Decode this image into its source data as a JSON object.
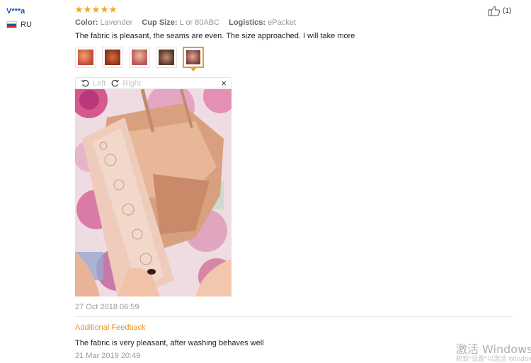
{
  "reviewer": {
    "name": "V***a",
    "country_code": "RU",
    "flag_icon": "russia-flag-icon"
  },
  "rating": {
    "stars": 5,
    "max": 5,
    "color": "#f5a623"
  },
  "attributes": [
    {
      "label": "Color:",
      "value": "Lavender"
    },
    {
      "label": "Cup Size:",
      "value": "L or 80ABC"
    },
    {
      "label": "Logistics:",
      "value": "ePacket"
    }
  ],
  "review_text": "The fabric is pleasant, the seams are even. The size approached. I will take more",
  "thumbnails": {
    "count": 5,
    "active_index": 4,
    "active_border_color": "#e79a36"
  },
  "viewer": {
    "rotate_left_label": "Left",
    "rotate_right_label": "Right",
    "close_glyph": "×"
  },
  "review_date": "27 Oct 2018 06:59",
  "additional_feedback": {
    "title": "Additional Feedback",
    "text": "The fabric is very pleasant, after washing behaves well",
    "date": "21 Mar 2019 20:49",
    "title_color": "#e7932b"
  },
  "helpful": {
    "count": "(1)",
    "icon": "thumbs-up-icon"
  },
  "watermark": {
    "line1": "激活 Windows",
    "line2": "转到\"设置\"以激活 Windows。"
  }
}
